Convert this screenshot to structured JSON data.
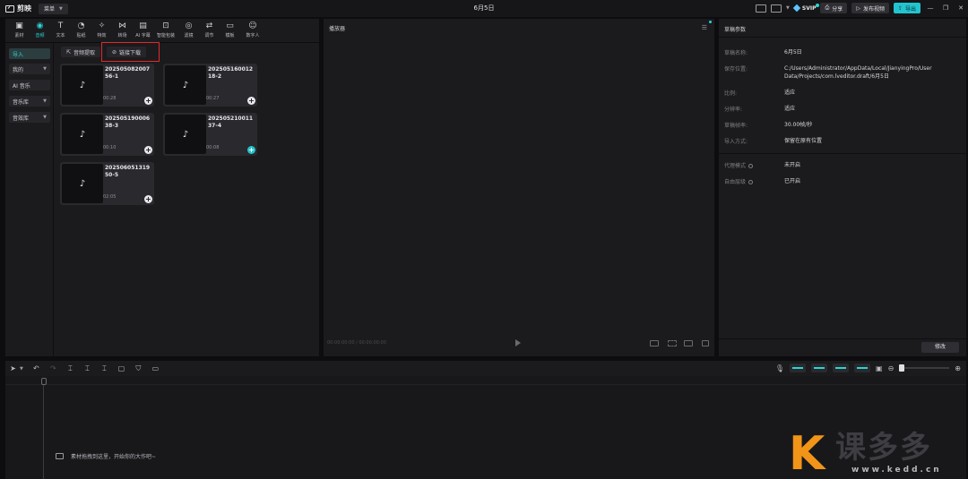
{
  "app": {
    "name": "剪映",
    "menu_label": "菜单",
    "window_title": "6月5日",
    "svip_label": "SVIP",
    "share_label": "分享",
    "publish_label": "发布视频",
    "export_label": "导出",
    "window_controls": [
      "—",
      "❐",
      "✕"
    ]
  },
  "toolbar": {
    "items": [
      {
        "label": "素材",
        "icon": "media-icon"
      },
      {
        "label": "音频",
        "icon": "audio-icon",
        "active": true
      },
      {
        "label": "文本",
        "icon": "text-icon"
      },
      {
        "label": "贴纸",
        "icon": "sticker-icon"
      },
      {
        "label": "特效",
        "icon": "effects-icon"
      },
      {
        "label": "转场",
        "icon": "transition-icon"
      },
      {
        "label": "AI 字幕",
        "icon": "ai-caption-icon"
      },
      {
        "label": "智能包装",
        "icon": "smart-pack-icon"
      },
      {
        "label": "滤镜",
        "icon": "filter-icon"
      },
      {
        "label": "调节",
        "icon": "adjust-icon"
      },
      {
        "label": "模板",
        "icon": "template-icon"
      },
      {
        "label": "数字人",
        "icon": "avatar-icon"
      }
    ]
  },
  "sidebar": {
    "items": [
      {
        "label": "导入",
        "active": true,
        "dropdown": false
      },
      {
        "label": "我的",
        "active": false,
        "dropdown": true
      },
      {
        "label": "AI 音乐",
        "active": false,
        "dropdown": false
      },
      {
        "label": "音乐库",
        "active": false,
        "dropdown": true
      },
      {
        "label": "音效库",
        "active": false,
        "dropdown": true
      }
    ]
  },
  "media": {
    "extract_label": "音频提取",
    "link_download_label": "链接下载",
    "cards": [
      {
        "name": "20250508200756-1",
        "duration": "00:28",
        "added": false
      },
      {
        "name": "20250516001218-2",
        "duration": "00:27",
        "added": false
      },
      {
        "name": "20250519000638-3",
        "duration": "00:10",
        "added": false
      },
      {
        "name": "20250521001137-4",
        "duration": "00:08",
        "added": true
      },
      {
        "name": "20250605131950-5",
        "duration": "02:05",
        "added": false
      }
    ]
  },
  "player": {
    "title": "播放器",
    "timecode": "00:00:00:00 / 00:00:00:00"
  },
  "props": {
    "title": "草稿参数",
    "rows": [
      {
        "label": "草稿名称:",
        "value": "6月5日"
      },
      {
        "label": "保存位置:",
        "value": "C:/Users/Administrator/AppData/Local/JianyingPro/User Data/Projects/com.lveditor.draft/6月5日"
      },
      {
        "label": "比例:",
        "value": "适应"
      },
      {
        "label": "分辨率:",
        "value": "适应"
      },
      {
        "label": "草稿帧率:",
        "value": "30.00帧/秒"
      },
      {
        "label": "导入方式:",
        "value": "保留在原有位置"
      },
      {
        "label": "代理模式",
        "value": "未开启"
      },
      {
        "label": "自由层级",
        "value": "已开启"
      }
    ],
    "modify_label": "修改"
  },
  "timeline": {
    "hint": "素材拖拽到这里，开始你的大作吧~"
  },
  "watermark": {
    "brand_chars": "课多多",
    "url": "www.kedd.cn"
  }
}
